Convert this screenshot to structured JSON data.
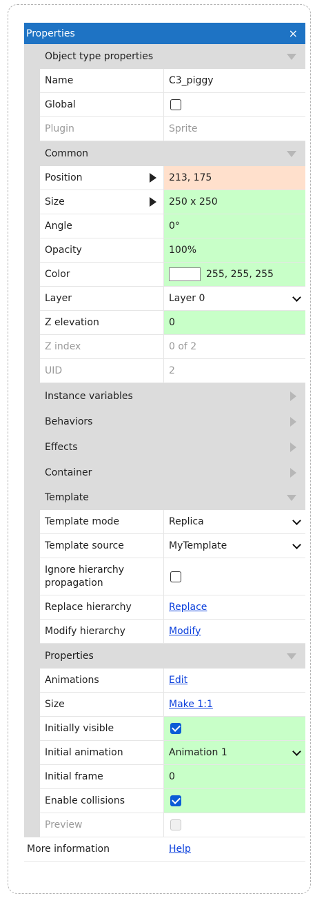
{
  "title": "Properties",
  "close_glyph": "×",
  "sections": {
    "object_type": "Object type properties",
    "common": "Common",
    "instance_variables": "Instance variables",
    "behaviors": "Behaviors",
    "effects": "Effects",
    "container": "Container",
    "template": "Template",
    "properties": "Properties"
  },
  "rows": {
    "name": {
      "label": "Name",
      "value": "C3_piggy"
    },
    "global": {
      "label": "Global",
      "checked": false
    },
    "plugin": {
      "label": "Plugin",
      "value": "Sprite"
    },
    "position": {
      "label": "Position",
      "value": "213, 175"
    },
    "size": {
      "label": "Size",
      "value": "250 x 250"
    },
    "angle": {
      "label": "Angle",
      "value": "0°"
    },
    "opacity": {
      "label": "Opacity",
      "value": "100%"
    },
    "color": {
      "label": "Color",
      "value": "255, 255, 255",
      "swatch": "#ffffff"
    },
    "layer": {
      "label": "Layer",
      "value": "Layer 0"
    },
    "z_elevation": {
      "label": "Z elevation",
      "value": "0"
    },
    "z_index": {
      "label": "Z index",
      "value": "0 of 2"
    },
    "uid": {
      "label": "UID",
      "value": "2"
    },
    "template_mode": {
      "label": "Template mode",
      "value": "Replica"
    },
    "template_source": {
      "label": "Template source",
      "value": "MyTemplate"
    },
    "ignore_hierarchy": {
      "label_line1": "Ignore hierarchy",
      "label_line2": "propagation",
      "checked": false
    },
    "replace_hierarchy": {
      "label": "Replace hierarchy",
      "link": "Replace"
    },
    "modify_hierarchy": {
      "label": "Modify hierarchy",
      "link": "Modify"
    },
    "animations": {
      "label": "Animations",
      "link": "Edit"
    },
    "size2": {
      "label": "Size",
      "link": "Make 1:1"
    },
    "initially_visible": {
      "label": "Initially visible",
      "checked": true
    },
    "initial_animation": {
      "label": "Initial animation",
      "value": "Animation 1"
    },
    "initial_frame": {
      "label": "Initial frame",
      "value": "0"
    },
    "enable_collisions": {
      "label": "Enable collisions",
      "checked": true
    },
    "preview": {
      "label": "Preview",
      "checked": false
    }
  },
  "footer": {
    "label": "More information",
    "link": "Help"
  },
  "colors": {
    "titlebar": "#1e73c4",
    "section_bg": "#dcdcdc",
    "changed_green": "#c8ffc8",
    "changed_orange": "#ffe0cc",
    "link": "#0a3fdc",
    "checkbox_checked": "#0b5cd6"
  }
}
